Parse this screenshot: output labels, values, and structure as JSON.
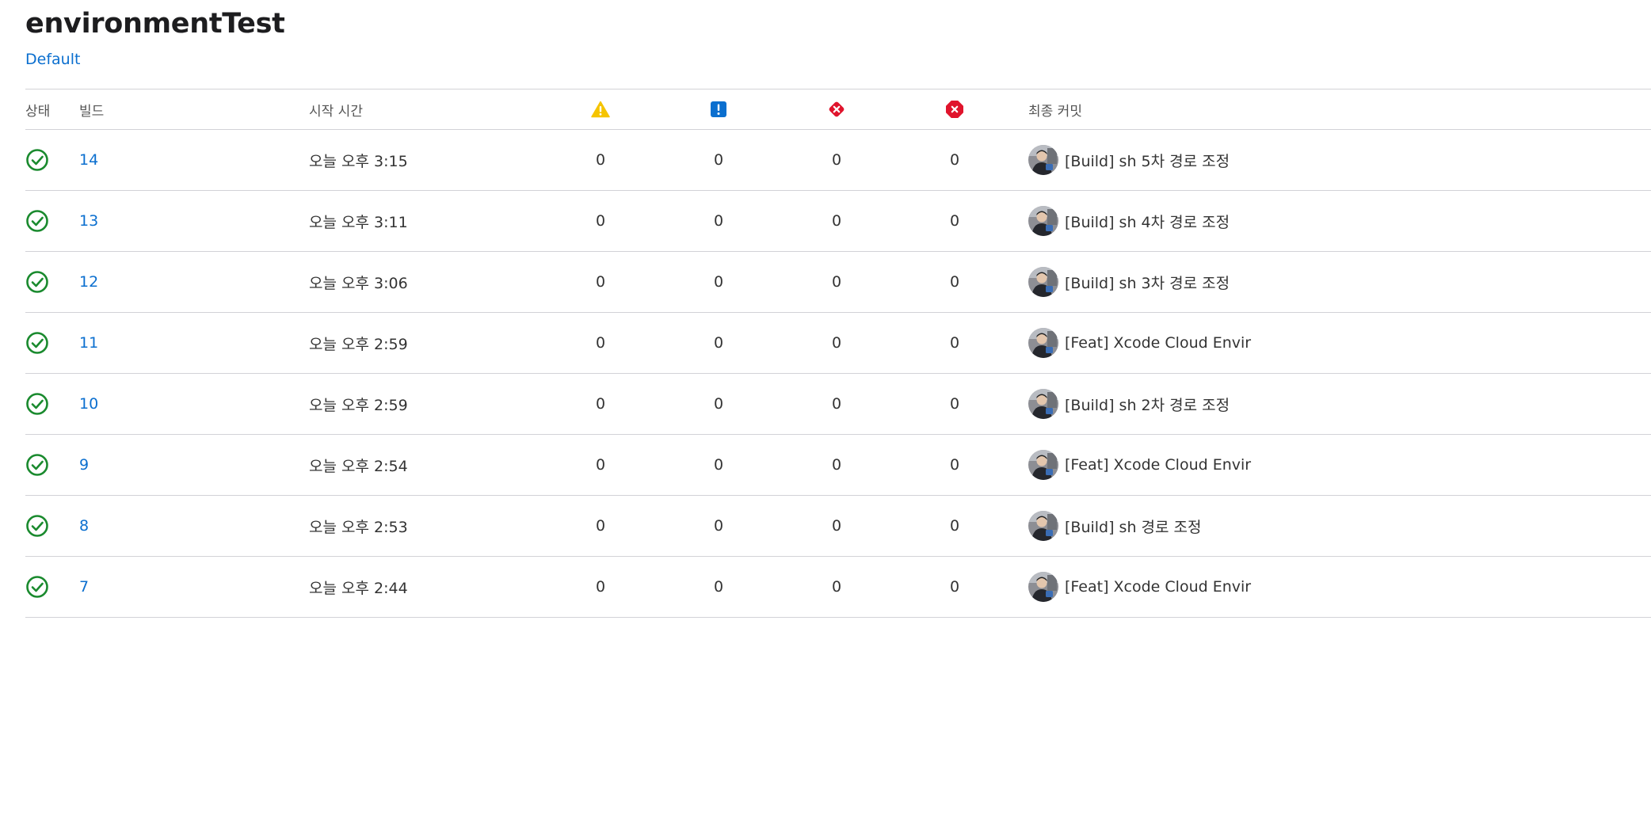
{
  "title": "environmentTest",
  "branch": "Default",
  "colors": {
    "link": "#0b6fcf",
    "success": "#1a8a2e",
    "warning": "#f5c400",
    "analyzer": "#0b6fcf",
    "error": "#e0142c"
  },
  "headers": {
    "status": "상태",
    "build": "빌드",
    "start_time": "시작 시간",
    "warnings_icon": "warning-triangle-icon",
    "analyzer_icon": "analyzer-issue-icon",
    "errors_icon": "error-diamond-icon",
    "failures_icon": "test-failure-circle-icon",
    "last_commit": "최종 커밋"
  },
  "rows": [
    {
      "status": "success",
      "build": "14",
      "time": "오늘 오후 3:15",
      "warnings": "0",
      "analyzer": "0",
      "errors": "0",
      "failures": "0",
      "commit": "[Build] sh 5차 경로 조정"
    },
    {
      "status": "success",
      "build": "13",
      "time": "오늘 오후 3:11",
      "warnings": "0",
      "analyzer": "0",
      "errors": "0",
      "failures": "0",
      "commit": "[Build] sh 4차 경로 조정"
    },
    {
      "status": "success",
      "build": "12",
      "time": "오늘 오후 3:06",
      "warnings": "0",
      "analyzer": "0",
      "errors": "0",
      "failures": "0",
      "commit": "[Build] sh 3차 경로 조정"
    },
    {
      "status": "success",
      "build": "11",
      "time": "오늘 오후 2:59",
      "warnings": "0",
      "analyzer": "0",
      "errors": "0",
      "failures": "0",
      "commit": "[Feat] Xcode Cloud Envir"
    },
    {
      "status": "success",
      "build": "10",
      "time": "오늘 오후 2:59",
      "warnings": "0",
      "analyzer": "0",
      "errors": "0",
      "failures": "0",
      "commit": "[Build] sh 2차 경로 조정"
    },
    {
      "status": "success",
      "build": "9",
      "time": "오늘 오후 2:54",
      "warnings": "0",
      "analyzer": "0",
      "errors": "0",
      "failures": "0",
      "commit": "[Feat] Xcode Cloud Envir"
    },
    {
      "status": "success",
      "build": "8",
      "time": "오늘 오후 2:53",
      "warnings": "0",
      "analyzer": "0",
      "errors": "0",
      "failures": "0",
      "commit": "[Build] sh 경로 조정"
    },
    {
      "status": "success",
      "build": "7",
      "time": "오늘 오후 2:44",
      "warnings": "0",
      "analyzer": "0",
      "errors": "0",
      "failures": "0",
      "commit": "[Feat] Xcode Cloud Envir"
    }
  ]
}
